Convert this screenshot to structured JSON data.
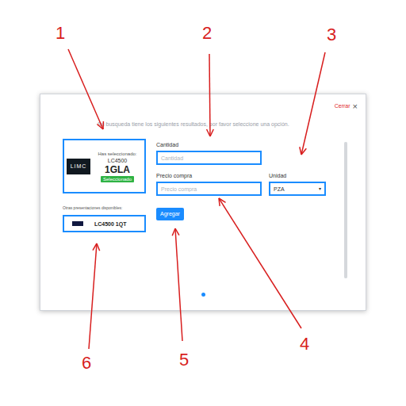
{
  "annotations": [
    {
      "label": "1"
    },
    {
      "label": "2"
    },
    {
      "label": "3"
    },
    {
      "label": "4"
    },
    {
      "label": "5"
    },
    {
      "label": "6"
    }
  ],
  "dialog": {
    "close": "Cerrar",
    "close_icon": "×",
    "message": "Su busqueda tiene los siguientes resultados, por favor seleccione una opción.",
    "selected": {
      "logo": "LIMC",
      "heading": "Has seleccionado:",
      "product": "LC4500",
      "presentation": "1GLA",
      "badge": "Seleccionado"
    },
    "others_label": "Otras presentaciones disponibles:",
    "others": [
      {
        "name": "LC4500 1QT"
      }
    ],
    "fields": {
      "quantity": {
        "label": "Cantidad",
        "placeholder": "Cantidad"
      },
      "price": {
        "label": "Precio compra",
        "placeholder": "Precio compra"
      },
      "unit": {
        "label": "Unidad",
        "value": "PZA",
        "arrow": "▾"
      }
    },
    "add_button": "Agregar",
    "pages": [
      {
        "selected": true
      }
    ]
  }
}
